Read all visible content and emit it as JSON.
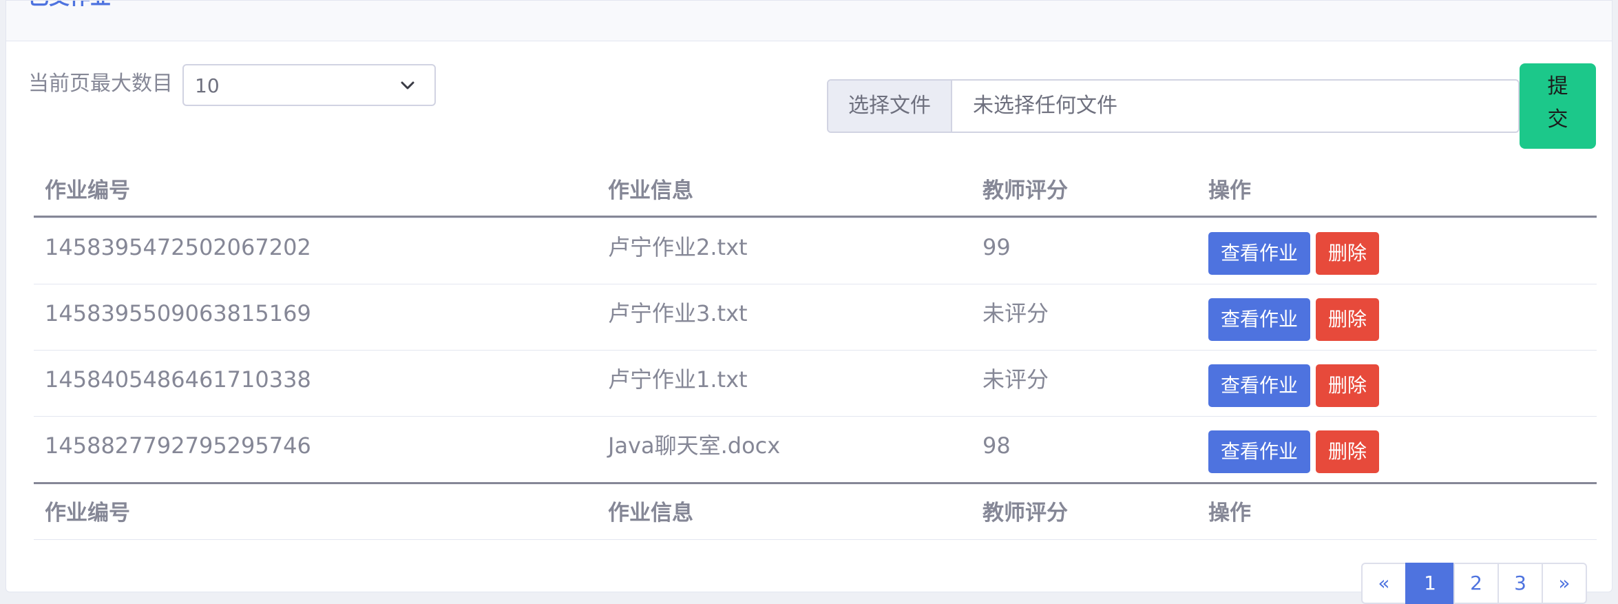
{
  "card": {
    "title": "已交作业"
  },
  "length": {
    "label": "当前页最大数目",
    "value": "10"
  },
  "upload": {
    "choose_label": "选择文件",
    "file_status": "未选择任何文件",
    "submit_label": "提交"
  },
  "table": {
    "headers": [
      "作业编号",
      "作业信息",
      "教师评分",
      "操作"
    ],
    "rows": [
      {
        "id": "1458395472502067202",
        "info": "卢宁作业2.txt",
        "score": "99"
      },
      {
        "id": "1458395509063815169",
        "info": "卢宁作业3.txt",
        "score": "未评分"
      },
      {
        "id": "1458405486461710338",
        "info": "卢宁作业1.txt",
        "score": "未评分"
      },
      {
        "id": "1458827792795295746",
        "info": "Java聊天室.docx",
        "score": "98"
      }
    ],
    "view_label": "查看作业",
    "delete_label": "删除"
  },
  "pagination": {
    "prev": "«",
    "pages": [
      "1",
      "2",
      "3"
    ],
    "next": "»",
    "active": "1"
  },
  "colors": {
    "primary": "#4e73df",
    "success": "#1cc88a",
    "danger": "#e74a3b",
    "text": "#858796"
  }
}
